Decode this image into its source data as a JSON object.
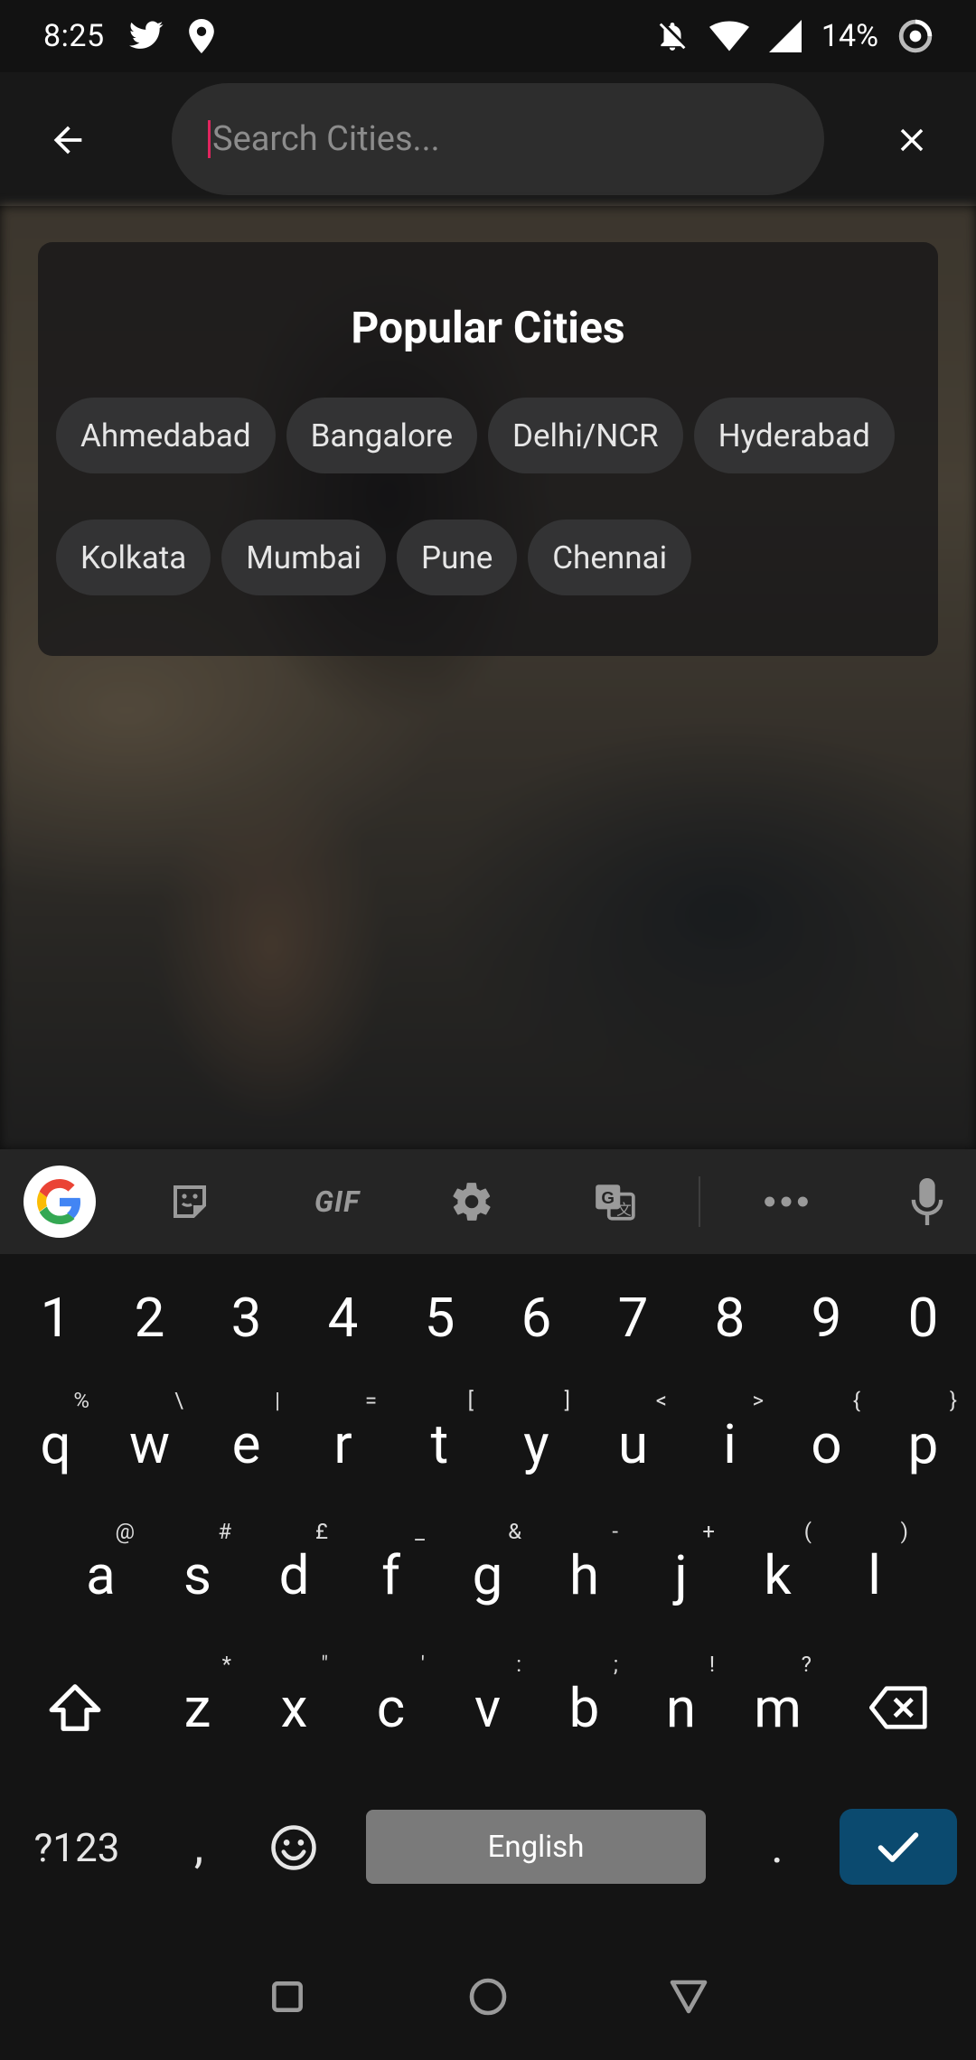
{
  "status_bar": {
    "time": "8:25",
    "battery": "14%",
    "icons": [
      "twitter-icon",
      "location-pin-icon",
      "notifications-off-icon",
      "wifi-icon",
      "signal-icon",
      "battery-saver-icon"
    ]
  },
  "app_bar": {
    "search_placeholder": "Search Cities...",
    "search_value": "",
    "back_icon": "arrow-back-icon",
    "clear_icon": "close-icon"
  },
  "popular_cities": {
    "title": "Popular Cities",
    "row1": [
      "Ahmedabad",
      "Bangalore",
      "Delhi/NCR",
      "Hyderabad"
    ],
    "row2": [
      "Kolkata",
      "Mumbai",
      "Pune",
      "Chennai"
    ]
  },
  "keyboard": {
    "toolbar": [
      "google-icon",
      "sticker-icon",
      "gif-icon",
      "settings-icon",
      "translate-icon",
      "more-icon",
      "mic-icon"
    ],
    "gif_label": "GIF",
    "numbers": [
      "1",
      "2",
      "3",
      "4",
      "5",
      "6",
      "7",
      "8",
      "9",
      "0"
    ],
    "row_q": [
      {
        "k": "q",
        "h": "%"
      },
      {
        "k": "w",
        "h": "\\"
      },
      {
        "k": "e",
        "h": "|"
      },
      {
        "k": "r",
        "h": "="
      },
      {
        "k": "t",
        "h": "["
      },
      {
        "k": "y",
        "h": "]"
      },
      {
        "k": "u",
        "h": "<"
      },
      {
        "k": "i",
        "h": ">"
      },
      {
        "k": "o",
        "h": "{"
      },
      {
        "k": "p",
        "h": "}"
      }
    ],
    "row_a": [
      {
        "k": "a",
        "h": "@"
      },
      {
        "k": "s",
        "h": "#"
      },
      {
        "k": "d",
        "h": "£"
      },
      {
        "k": "f",
        "h": "_"
      },
      {
        "k": "g",
        "h": "&"
      },
      {
        "k": "h",
        "h": "-"
      },
      {
        "k": "j",
        "h": "+"
      },
      {
        "k": "k",
        "h": "("
      },
      {
        "k": "l",
        "h": ")"
      }
    ],
    "row_z": [
      {
        "k": "z",
        "h": "*"
      },
      {
        "k": "x",
        "h": "\""
      },
      {
        "k": "c",
        "h": "'"
      },
      {
        "k": "v",
        "h": ":"
      },
      {
        "k": "b",
        "h": ";"
      },
      {
        "k": "n",
        "h": "!"
      },
      {
        "k": "m",
        "h": "?"
      }
    ],
    "symbols_label": "?123",
    "comma": ",",
    "space_label": "English",
    "period": ".",
    "enter_icon": "check-icon",
    "shift_icon": "shift-icon",
    "backspace_icon": "backspace-icon",
    "emoji_icon": "emoji-icon"
  },
  "nav_bar": {
    "icons": [
      "recents-square-icon",
      "home-circle-icon",
      "back-triangle-icon"
    ]
  },
  "colors": {
    "accent_caret": "#e0245e",
    "enter_key": "#0b4a6f",
    "chip_bg": "#333334"
  }
}
